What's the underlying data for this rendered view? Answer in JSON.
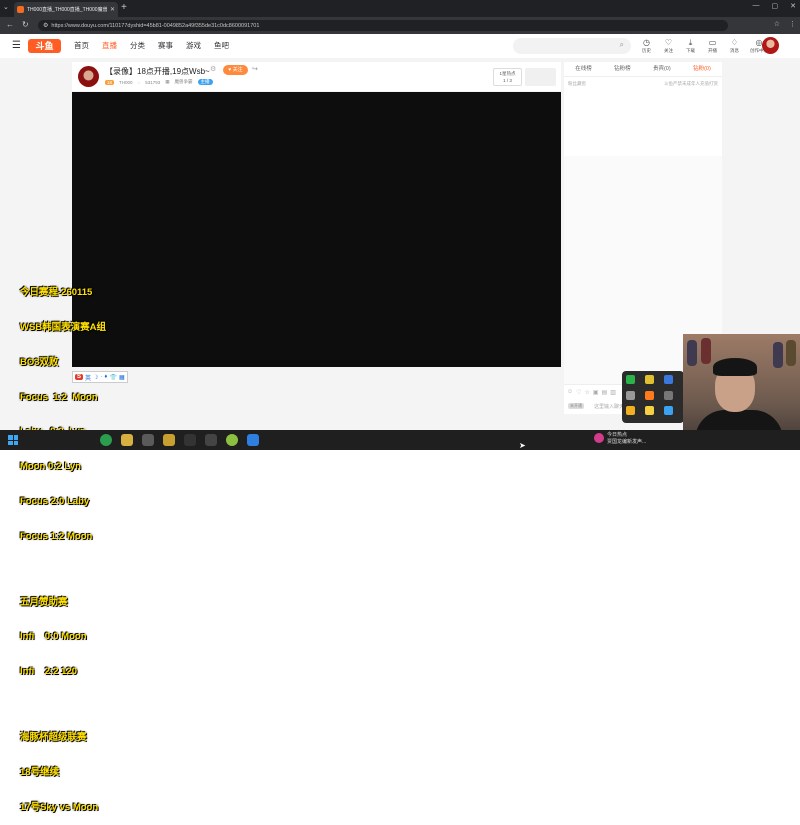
{
  "browser": {
    "tab_title": "TH000直播_TH000直播_TH000魔兽",
    "tab_close": "✕",
    "tab_dropdown": "⌄",
    "new_tab": "+",
    "url": "https://www.douyu.com/110177dyshid=45b81-0049852a49f355de31c0dc8600091701",
    "window_controls": [
      "—",
      "▢",
      "✕"
    ]
  },
  "header": {
    "logo": "斗鱼",
    "nav": [
      "首页",
      "直播",
      "分类",
      "赛事",
      "游戏",
      "鱼吧"
    ],
    "search_placeholder": "",
    "tools": [
      {
        "icon": "◷",
        "label": "历史"
      },
      {
        "icon": "♡",
        "label": "关注"
      },
      {
        "icon": "⤓",
        "label": "下载"
      },
      {
        "icon": "▭",
        "label": "开播"
      },
      {
        "icon": "♢",
        "label": "消息"
      },
      {
        "icon": "◎",
        "label": "创作中心"
      }
    ]
  },
  "room": {
    "title": "【录像】18点开播,19点Wsb~",
    "follow": "♥ 关注",
    "level": "18",
    "anchor": "TH000",
    "hot": "531793",
    "category": "魔兽争霸",
    "tag": "主播",
    "rank_label": "1星热点",
    "rank_value": "1 / 3"
  },
  "side": {
    "tabs": [
      "在线榜",
      "钻粉榜",
      "贵宾(0)",
      "钻粉(0)"
    ],
    "notice_left": "粉丝藏窖",
    "notice_right": "斗鱼严禁未成年人充值打赏",
    "chat_level": "未开通",
    "chat_placeholder": "这里输入聊天内容",
    "chat_icons": [
      "☺",
      "♡",
      "☆",
      "▣",
      "▤",
      "▥"
    ]
  },
  "overlay": {
    "lines_top": [
      "今日赛程-260115",
      "WSB韩国表演赛A组",
      "BO3双败",
      "Focus  1:2  Moon",
      "Laby   0:2  Lyn",
      "Moon 0:2 Lyn",
      "Focus 2:0 Laby",
      "Focus 1:2 Moon"
    ],
    "lines_mid": [
      "五月赞助赛",
      "Infi    0:0 Moon",
      "Infi    2:2 120"
    ],
    "lines_bottom": [
      "海豚杯超级联赛",
      "18号继续",
      "17号Sky vs Moon"
    ]
  },
  "ime": {
    "logo": "S",
    "items": [
      "英",
      "☽",
      "·",
      "♦",
      "👕",
      "▦"
    ]
  },
  "taskbar": {
    "news_title": "今日热点",
    "news_sub": "贾国龙编新发声..."
  },
  "colors": {
    "brand": "#ff5d23",
    "overlay_text": "#ffe000"
  }
}
